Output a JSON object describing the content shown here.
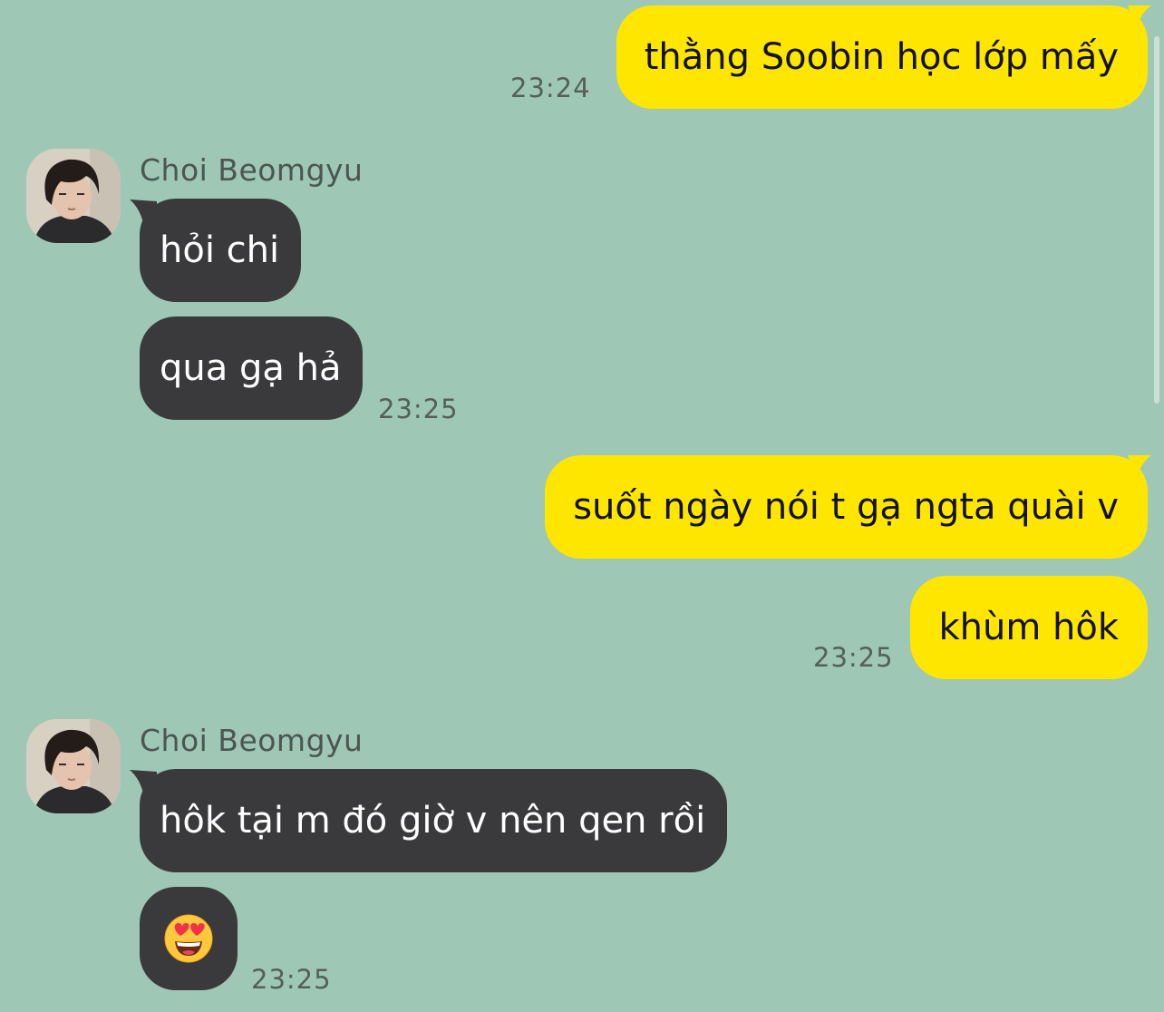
{
  "chat": {
    "contact_name": "Choi Beomgyu",
    "messages": [
      {
        "text": "thằng Soobin học lớp mấy",
        "time": "23:24"
      },
      {
        "text": "hỏi chi"
      },
      {
        "text": "qua gạ hả",
        "time": "23:25"
      },
      {
        "text": "suốt ngày nói t gạ ngta quài v"
      },
      {
        "text": "khùm hôk",
        "time": "23:25"
      },
      {
        "text": "hôk tại m đó giờ v nên qen rồi"
      },
      {
        "emoji": "heart-eyes-emoji",
        "time": "23:25"
      }
    ],
    "colors": {
      "background": "#9ec8b5",
      "outgoing_bubble": "#ffe600",
      "incoming_bubble": "#3a3a3c"
    }
  }
}
